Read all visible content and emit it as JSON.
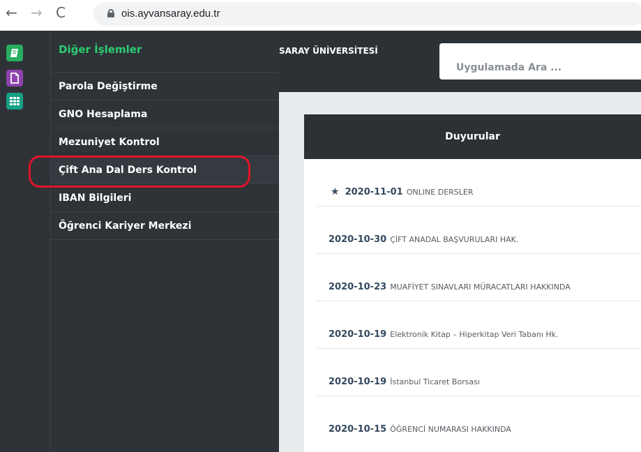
{
  "browser": {
    "back": "←",
    "forward": "→",
    "reload": "C",
    "url": "ois.ayvansaray.edu.tr"
  },
  "header": {
    "university": "SARAY ÜNİVERSİTESİ",
    "search_placeholder": "Uygulamada Ara ..."
  },
  "menu": {
    "title": "Diğer İşlemler",
    "items": [
      {
        "label": "Parola Değiştirme"
      },
      {
        "label": "GNO Hesaplama"
      },
      {
        "label": "Mezuniyet Kontrol"
      },
      {
        "label": "Çift Ana Dal Ders Kontrol"
      },
      {
        "label": "IBAN Bilgileri"
      },
      {
        "label": "Öğrenci Kariyer Merkezi"
      }
    ]
  },
  "announcements": {
    "title": "Duyurular",
    "items": [
      {
        "date": "2020-11-01",
        "text": "ONLINE DERSLER",
        "starred": true
      },
      {
        "date": "2020-10-30",
        "text": "ÇİFT ANADAL BAŞVURULARI HAK."
      },
      {
        "date": "2020-10-23",
        "text": "MUAFİYET SINAVLARI MÜRACATLARI HAKKINDA"
      },
      {
        "date": "2020-10-19",
        "text": "Elektronik Kitap – Hiperkitap Veri Tabanı Hk."
      },
      {
        "date": "2020-10-19",
        "text": "İstanbul Ticaret Borsası"
      },
      {
        "date": "2020-10-15",
        "text": "ÖĞRENCİ NUMARASI HAKKINDA"
      }
    ]
  },
  "colors": {
    "sidebar_bg": "#2e3338",
    "accent_green": "#2ecc71",
    "highlight_red": "#e0142a"
  }
}
